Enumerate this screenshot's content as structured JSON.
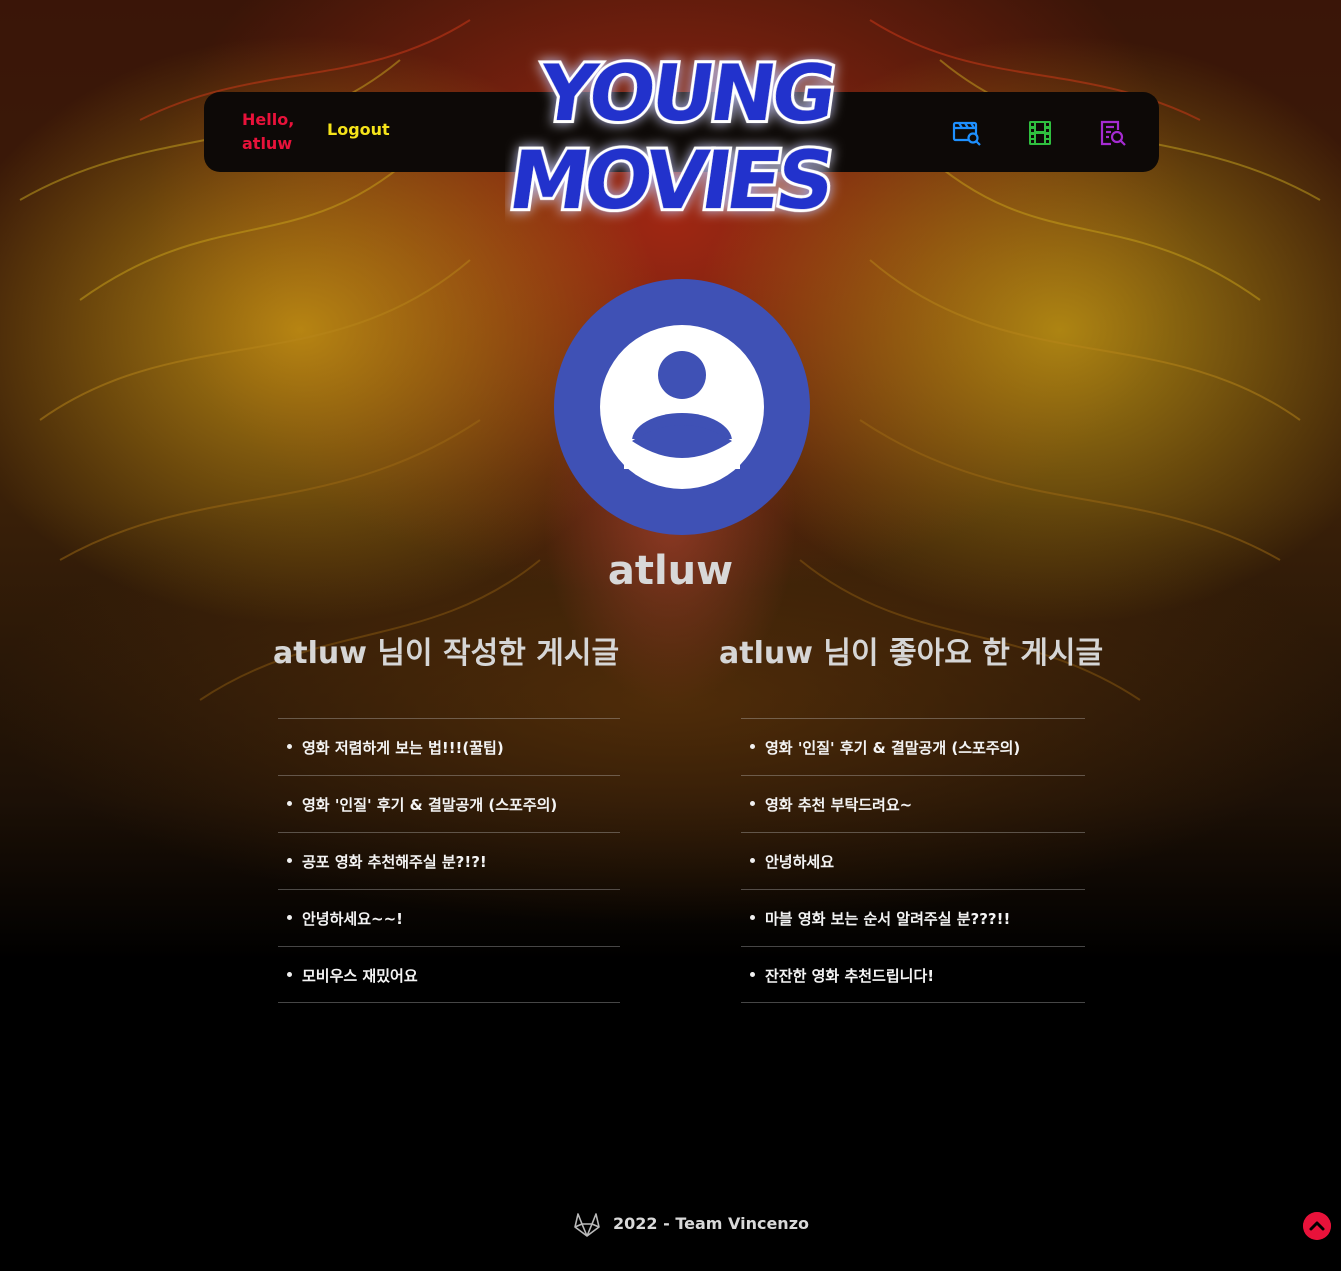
{
  "header": {
    "greeting": "Hello, atluw",
    "logout_label": "Logout",
    "logo_line1": "YOUNG",
    "logo_line2": "MOVIES",
    "icons": [
      "movie-search-icon",
      "film-icon",
      "review-search-icon"
    ]
  },
  "profile": {
    "username": "atluw"
  },
  "written_posts": {
    "title": "atluw 님이 작성한 게시글",
    "items": [
      "영화 저렴하게 보는 법!!!(꿀팁)",
      "영화 '인질' 후기 & 결말공개 (스포주의)",
      "공포 영화 추천해주실 분?!?!",
      "안녕하세요~~!",
      "모비우스 재밌어요"
    ]
  },
  "liked_posts": {
    "title": "atluw 님이 좋아요 한 게시글",
    "items": [
      "영화 '인질' 후기 & 결말공개 (스포주의)",
      "영화 추천 부탁드려요~",
      "안녕하세요",
      "마블 영화 보는 순서 알려주실 분???!!",
      "잔잔한 영화 추천드립니다!"
    ]
  },
  "footer": {
    "text": "2022 - Team Vincenzo"
  },
  "colors": {
    "greeting": "#e8123a",
    "logout": "#f5e31a",
    "logo": "#2233cc",
    "avatar": "#3f51b5",
    "icon_blue": "#1e90ff",
    "icon_green": "#2fbf3f",
    "icon_purple": "#a52bd1"
  }
}
